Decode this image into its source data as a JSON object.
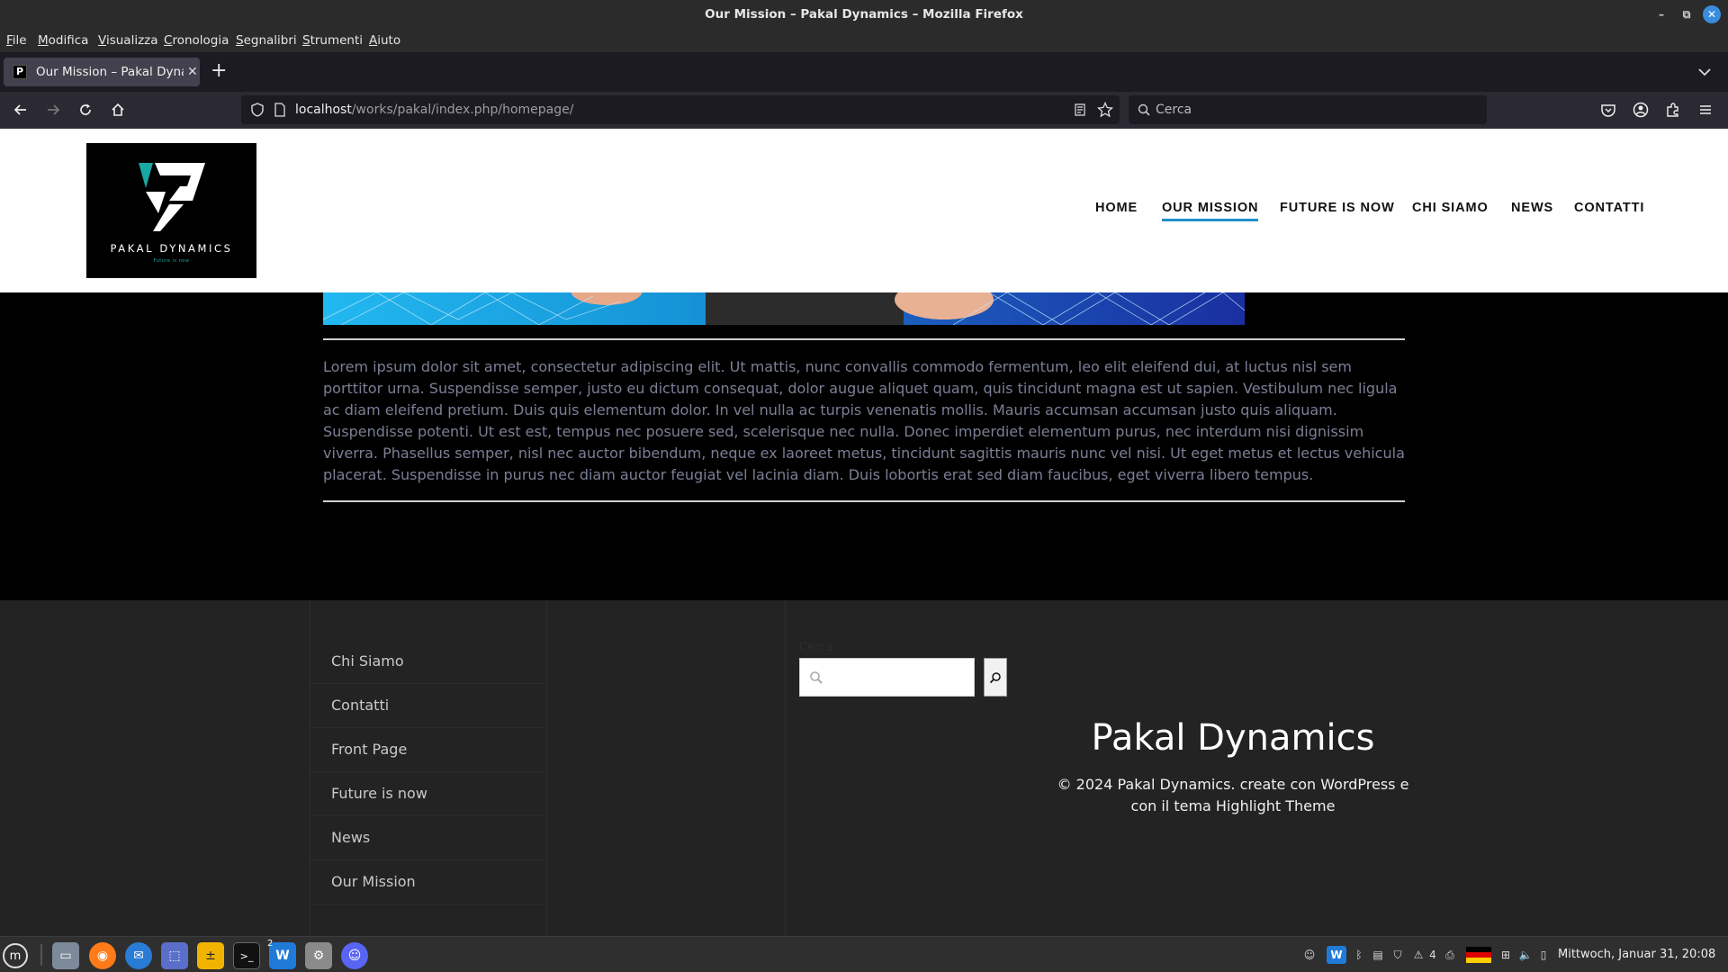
{
  "window": {
    "title": "Our Mission – Pakal Dynamics – Mozilla Firefox"
  },
  "menubar": [
    "File",
    "Modifica",
    "Visualizza",
    "Cronologia",
    "Segnalibri",
    "Strumenti",
    "Aiuto"
  ],
  "tab": {
    "title": "Our Mission – Pakal Dynamics",
    "favicon": "P"
  },
  "urlbar": {
    "host": "localhost",
    "path": "/works/pakal/index.php/homepage/"
  },
  "searchbar": {
    "placeholder": "Cerca"
  },
  "site": {
    "logo": {
      "brand": "PAKAL DYNAMICS",
      "tagline": "Future is now"
    },
    "nav": [
      "HOME",
      "OUR MISSION",
      "FUTURE IS NOW",
      "CHI SIAMO",
      "NEWS",
      "CONTATTI"
    ],
    "nav_active": "OUR MISSION",
    "body_text": "Lorem ipsum dolor sit amet, consectetur adipiscing elit. Ut mattis, nunc convallis commodo fermentum, leo elit eleifend dui, at luctus nisl sem porttitor urna. Suspendisse semper, justo eu dictum consequat, dolor augue aliquet quam, quis tincidunt magna est ut sapien. Vestibulum nec ligula ac diam eleifend pretium. Duis quis elementum dolor. In vel nulla ac turpis venenatis mollis. Mauris accumsan accumsan justo quis aliquam. Suspendisse potenti. Ut est est, tempus nec posuere sed, scelerisque nec nulla. Donec imperdiet elementum purus, nec interdum nisi dignissim viverra. Phasellus semper, nisl nec auctor bibendum, neque ex laoreet metus, tincidunt sagittis mauris nunc vel nisi. Ut eget metus et lectus vehicula placerat. Suspendisse in purus nec diam auctor feugiat vel lacinia diam. Duis lobortis erat sed diam faucibus, eget viverra libero tempus.",
    "footer": {
      "menu": [
        "Chi Siamo",
        "Contatti",
        "Front Page",
        "Future is now",
        "News",
        "Our Mission"
      ],
      "search_label": "Cerca",
      "brand": "Pakal Dynamics",
      "copyright": "©  2024 Pakal Dynamics. create con WordPress e con il tema Highlight Theme"
    }
  },
  "taskbar": {
    "apps": [
      "menu-icon",
      "files-icon",
      "firefox-icon",
      "thunderbird-icon",
      "screenshot-icon",
      "calculator-icon",
      "terminal-icon",
      "webstorm-icon",
      "settings-icon",
      "discord-icon"
    ],
    "webstorm_badge": "2",
    "tray_count": "4",
    "clock": "Mittwoch, Januar 31, 20:08"
  },
  "colors": {
    "accent": "#1e90c9",
    "footer_bg": "#232323",
    "logo_teal": "#1aa8a2"
  }
}
